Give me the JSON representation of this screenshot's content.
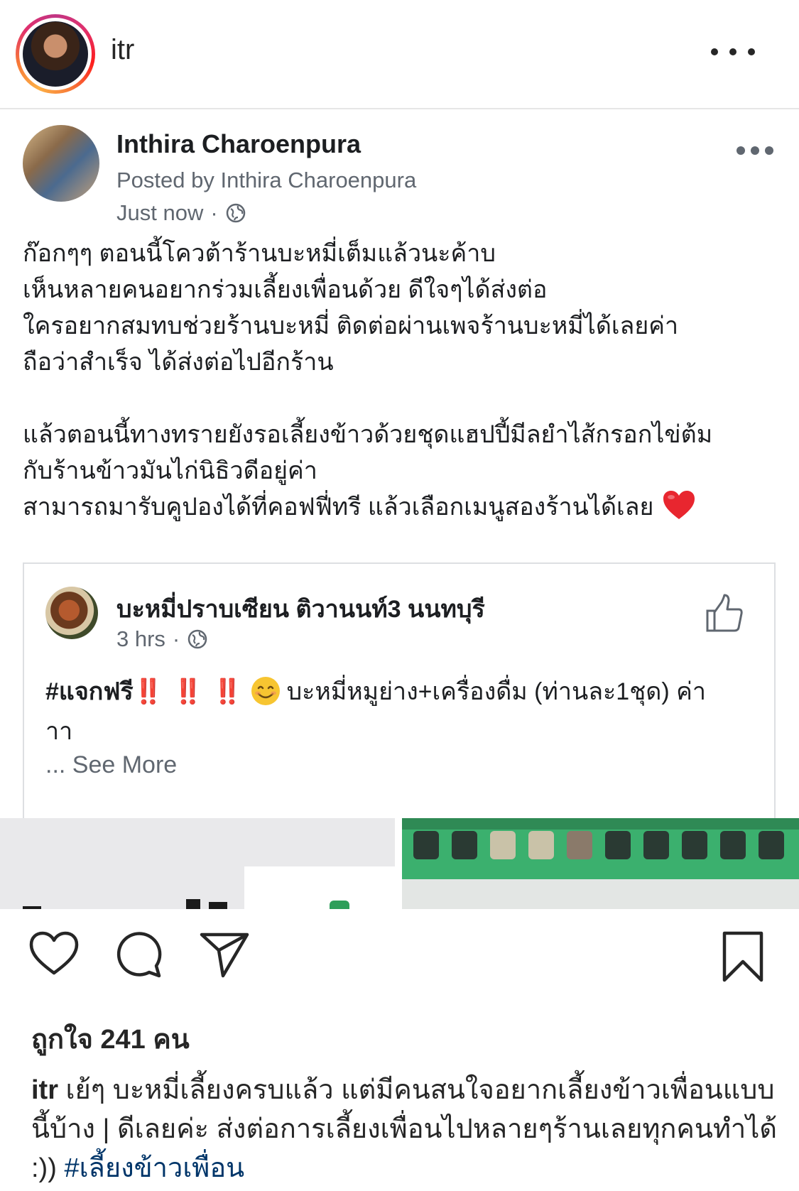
{
  "ig_header": {
    "username": "itr",
    "more_icon": "more-horizontal-icon"
  },
  "fb_post": {
    "author": "Inthira Charoenpura",
    "posted_by": "Posted by Inthira Charoenpura",
    "time": "Just now",
    "separator": "·",
    "privacy_icon": "globe-icon",
    "more_icon": "more-horizontal-icon",
    "paragraphs": [
      [
        "ก๊อกๆๆ ตอนนี้โควต้าร้านบะหมี่เต็มแล้วนะค้าบ",
        "เห็นหลายคนอยากร่วมเลี้ยงเพื่อนด้วย ดีใจๆได้ส่งต่อ",
        "ใครอยากสมทบช่วยร้านบะหมี่ ติดต่อผ่านเพจร้านบะหมี่ได้เลยค่า",
        "ถือว่าสำเร็จ ได้ส่งต่อไปอีกร้าน"
      ],
      [
        "แล้วตอนนี้ทางทรายยังรอเลี้ยงข้าวด้วยชุดแฮปปี้มีลยำไส้กรอกไข่ต้ม",
        "กับร้านข้าวมันไก่นิธิวดีอยู่ค่า",
        "สามารถมารับคูปองได้ที่คอฟฟี่ทรี แล้วเลือกเมนูสองร้านได้เลย"
      ]
    ],
    "end_emoji": "red-heart"
  },
  "shared_post": {
    "page_name": "บะหมี่ปราบเซียน ติวานนท์3 นนทบุรี",
    "time": "3 hrs",
    "separator": "·",
    "like_icon": "thumbs-up-icon",
    "hashtag": "#แจกฟรี",
    "exclaims": "‼️ ‼️ ‼️",
    "smiley": "smiling-face",
    "text_line1": "บะหมี่หมูย่าง+เครื่องดื่ม (ท่านละ1ชุด) ค่า",
    "text_line2": "าา",
    "see_more": "... See More"
  },
  "actions": {
    "like": "heart-icon",
    "comment": "comment-bubble-icon",
    "share": "paper-plane-icon",
    "save": "bookmark-icon"
  },
  "likes_text": "ถูกใจ 241 คน",
  "caption": {
    "username": "itr",
    "text": " เย้ๆ บะหมี่เลี้ยงครบแล้ว แต่มีคนสนใจอยากเลี้ยงข้าวเพื่อนแบบนี้บ้าง | ดีเลยค่ะ ส่งต่อการเลี้ยงเพื่อนไปหลายๆร้านเลยทุกคนทำได้ :)) ",
    "hashtag": "#เลี้ยงข้าวเพื่อน"
  },
  "colors": {
    "fb_text": "#1c1e21",
    "fb_meta": "#606770",
    "hashtag_link": "#003569",
    "exclaim_red": "#e0242a"
  }
}
